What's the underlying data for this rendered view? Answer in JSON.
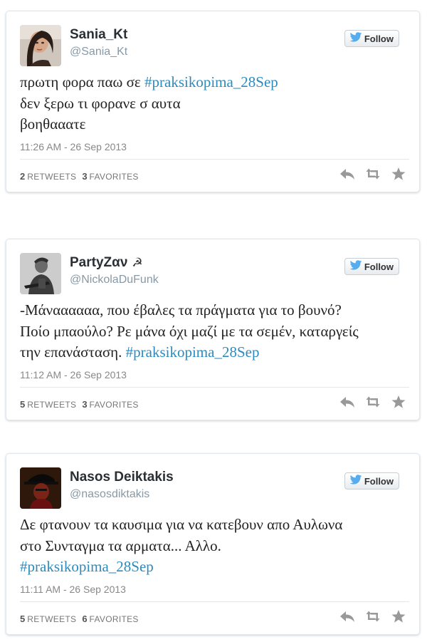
{
  "tweets": [
    {
      "name": "Sania_Kt",
      "handle": "@Sania_Kt",
      "follow_label": "Follow",
      "text_lines": [
        "πρωτη φορα παω σε ",
        "δεν ξερω τι φορανε σ αυτα",
        "βοηθααατε"
      ],
      "hashtag": "#praksikopima_28Sep",
      "timestamp": "11:26 AM - 26 Sep 2013",
      "retweets_count": "2",
      "retweets_label": "RETWEETS",
      "favorites_count": "3",
      "favorites_label": "FAVORITES"
    },
    {
      "name": "PartyZαν",
      "name_symbol": "☭",
      "handle": "@NickolaDuFunk",
      "follow_label": "Follow",
      "text_lines": [
        "-Μάναααααα, που έβαλες τα πράγματα για το βουνό?",
        "Ποίο μπαούλο? Ρε μάνα όχι μαζί με τα σεμέν, καταργείς",
        "την επανάσταση. "
      ],
      "hashtag": "#praksikopima_28Sep",
      "timestamp": "11:12 AM - 26 Sep 2013",
      "retweets_count": "5",
      "retweets_label": "RETWEETS",
      "favorites_count": "3",
      "favorites_label": "FAVORITES"
    },
    {
      "name": "Nasos Deiktakis",
      "handle": "@nasosdiktakis",
      "follow_label": "Follow",
      "text_lines": [
        "Δε φτανουν τα καυσιμα για να κατεβουν απο Αυλωνα",
        "στο Συνταγμα τα αρματα... Αλλο."
      ],
      "hashtag": "#praksikopima_28Sep",
      "timestamp": "11:11 AM - 26 Sep 2013",
      "retweets_count": "5",
      "retweets_label": "RETWEETS",
      "favorites_count": "6",
      "favorites_label": "FAVORITES"
    }
  ],
  "icons": {
    "twitter": "twitter-bird-icon",
    "reply": "reply-icon",
    "retweet": "retweet-icon",
    "favorite": "star-icon"
  },
  "colors": {
    "hashtag": "#2b8bbf",
    "twitter_blue": "#55acee",
    "action_gray": "#999999"
  }
}
